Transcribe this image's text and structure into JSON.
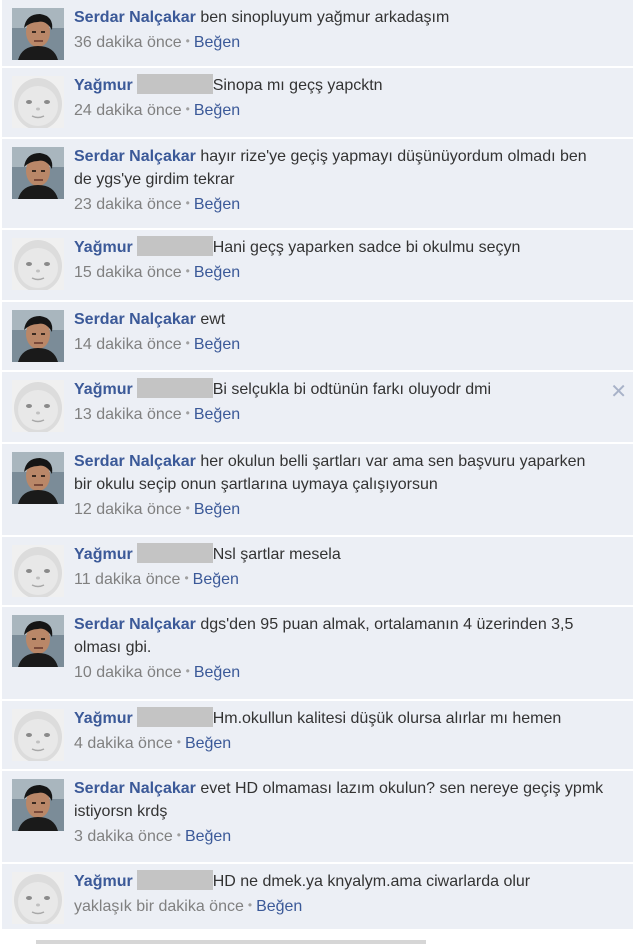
{
  "comments": [
    {
      "kind": "serdar",
      "author": "Serdar Nalçakar",
      "redacted": false,
      "text": "ben sinopluyum yağmur arkadaşım",
      "time": "36 dakika önce",
      "like": "Beğen",
      "close": false
    },
    {
      "kind": "yagmur",
      "author": "Yağmur",
      "redacted": true,
      "text": "Sinopa mı geçş yapcktn",
      "time": "24 dakika önce",
      "like": "Beğen",
      "close": false
    },
    {
      "kind": "serdar",
      "author": "Serdar Nalçakar",
      "redacted": false,
      "text": "hayır rize'ye geçiş yapmayı düşünüyordum olmadı ben de ygs'ye girdim tekrar",
      "time": "23 dakika önce",
      "like": "Beğen",
      "close": false
    },
    {
      "kind": "yagmur",
      "author": "Yağmur",
      "redacted": true,
      "text": "Hani geçş yaparken sadce bi okulmu seçyn",
      "time": "15 dakika önce",
      "like": "Beğen",
      "close": false
    },
    {
      "kind": "serdar",
      "author": "Serdar Nalçakar",
      "redacted": false,
      "text": "ewt",
      "time": "14 dakika önce",
      "like": "Beğen",
      "close": false
    },
    {
      "kind": "yagmur",
      "author": "Yağmur",
      "redacted": true,
      "text": "Bi selçukla bi odtünün farkı oluyodr dmi",
      "time": "13 dakika önce",
      "like": "Beğen",
      "close": true
    },
    {
      "kind": "serdar",
      "author": "Serdar Nalçakar",
      "redacted": false,
      "text": "her okulun belli şartları var ama sen başvuru yaparken bir okulu seçip onun şartlarına uymaya çalışıyorsun",
      "time": "12 dakika önce",
      "like": "Beğen",
      "close": false
    },
    {
      "kind": "yagmur",
      "author": "Yağmur",
      "redacted": true,
      "text": "Nsl şartlar mesela",
      "time": "11 dakika önce",
      "like": "Beğen",
      "close": false
    },
    {
      "kind": "serdar",
      "author": "Serdar Nalçakar",
      "redacted": false,
      "text": "dgs'den 95 puan almak, ortalamanın 4 üzerinden 3,5 olması gbi.",
      "time": "10 dakika önce",
      "like": "Beğen",
      "close": false
    },
    {
      "kind": "yagmur",
      "author": "Yağmur",
      "redacted": true,
      "text": "Hm.okullun kalitesi düşük olursa alırlar mı hemen",
      "time": "4 dakika önce",
      "like": "Beğen",
      "close": false
    },
    {
      "kind": "serdar",
      "author": "Serdar Nalçakar",
      "redacted": false,
      "text": "evet HD olmaması lazım okulun? sen nereye geçiş ypmk istiyorsn krdş",
      "time": "3 dakika önce",
      "like": "Beğen",
      "close": false
    },
    {
      "kind": "yagmur",
      "author": "Yağmur",
      "redacted": true,
      "text": "HD ne dmek.ya knyalym.ama ciwarlarda olur",
      "time": "yaklaşık bir dakika önce",
      "like": "Beğen",
      "close": false
    }
  ],
  "colors": {
    "background": "#eceff5",
    "author": "#3b5998",
    "meta": "#808080"
  },
  "icons": {
    "close": "close-icon",
    "serdar_avatar": "man-profile-photo",
    "yagmur_avatar": "baby-face-photo"
  }
}
